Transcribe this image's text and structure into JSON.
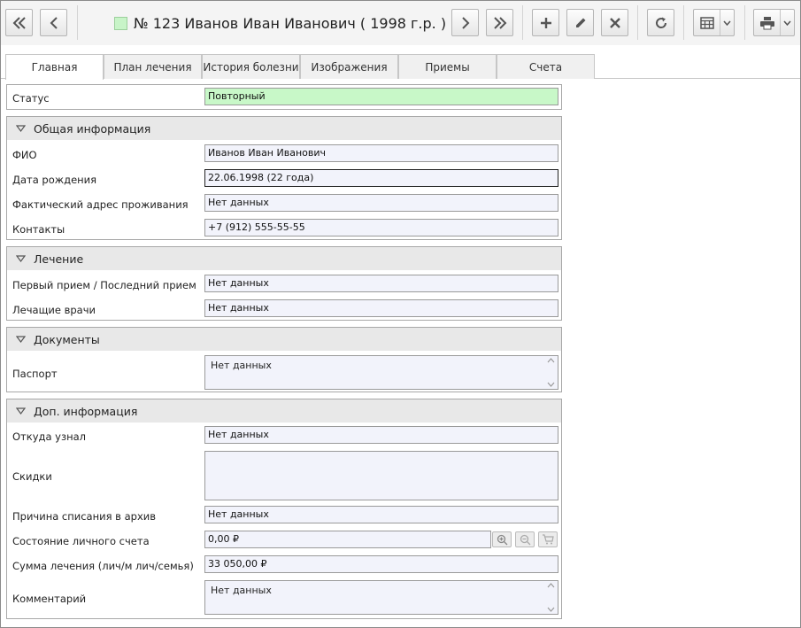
{
  "header": {
    "title": "№ 123 Иванов Иван Иванович ( 1998 г.р. )",
    "status_color": "#c8f4c8"
  },
  "toolbar": {
    "icons": [
      "first-record-icon",
      "prev-record-icon",
      "next-record-icon",
      "last-record-icon",
      "add-icon",
      "edit-icon",
      "delete-icon",
      "refresh-icon",
      "calendar-icon",
      "print-icon"
    ]
  },
  "tabs": [
    {
      "label": "Главная",
      "active": true
    },
    {
      "label": "План лечения"
    },
    {
      "label": "История болезни"
    },
    {
      "label": "Изображения"
    },
    {
      "label": "Приемы"
    },
    {
      "label": "Счета"
    }
  ],
  "status": {
    "label": "Статус",
    "value": "Повторный"
  },
  "general": {
    "title": "Общая информация",
    "fio_label": "ФИО",
    "fio": "Иванов Иван Иванович",
    "birth_label": "Дата рождения",
    "birth": "22.06.1998 (22 года)",
    "address_label": "Фактический адрес проживания",
    "address": "Нет данных",
    "contacts_label": "Контакты",
    "contacts": "+7 (912) 555-55-55"
  },
  "treatment": {
    "title": "Лечение",
    "visits_label": "Первый прием / Последний прием",
    "visits": "Нет данных",
    "doctors_label": "Лечащие врачи",
    "doctors": "Нет данных"
  },
  "documents": {
    "title": "Документы",
    "passport_label": "Паспорт",
    "passport": "Нет данных"
  },
  "extra": {
    "title": "Доп. информация",
    "source_label": "Откуда узнал",
    "source": "Нет данных",
    "discounts_label": "Скидки",
    "discounts": "",
    "archive_label": "Причина списания в архив",
    "archive": "Нет данных",
    "account_label": "Состояние личного счета",
    "account": "0,00 ₽",
    "sum_label": "Сумма лечения (лич/м лич/семья)",
    "sum": "33 050,00 ₽",
    "comment_label": "Комментарий",
    "comment": "Нет данных"
  }
}
